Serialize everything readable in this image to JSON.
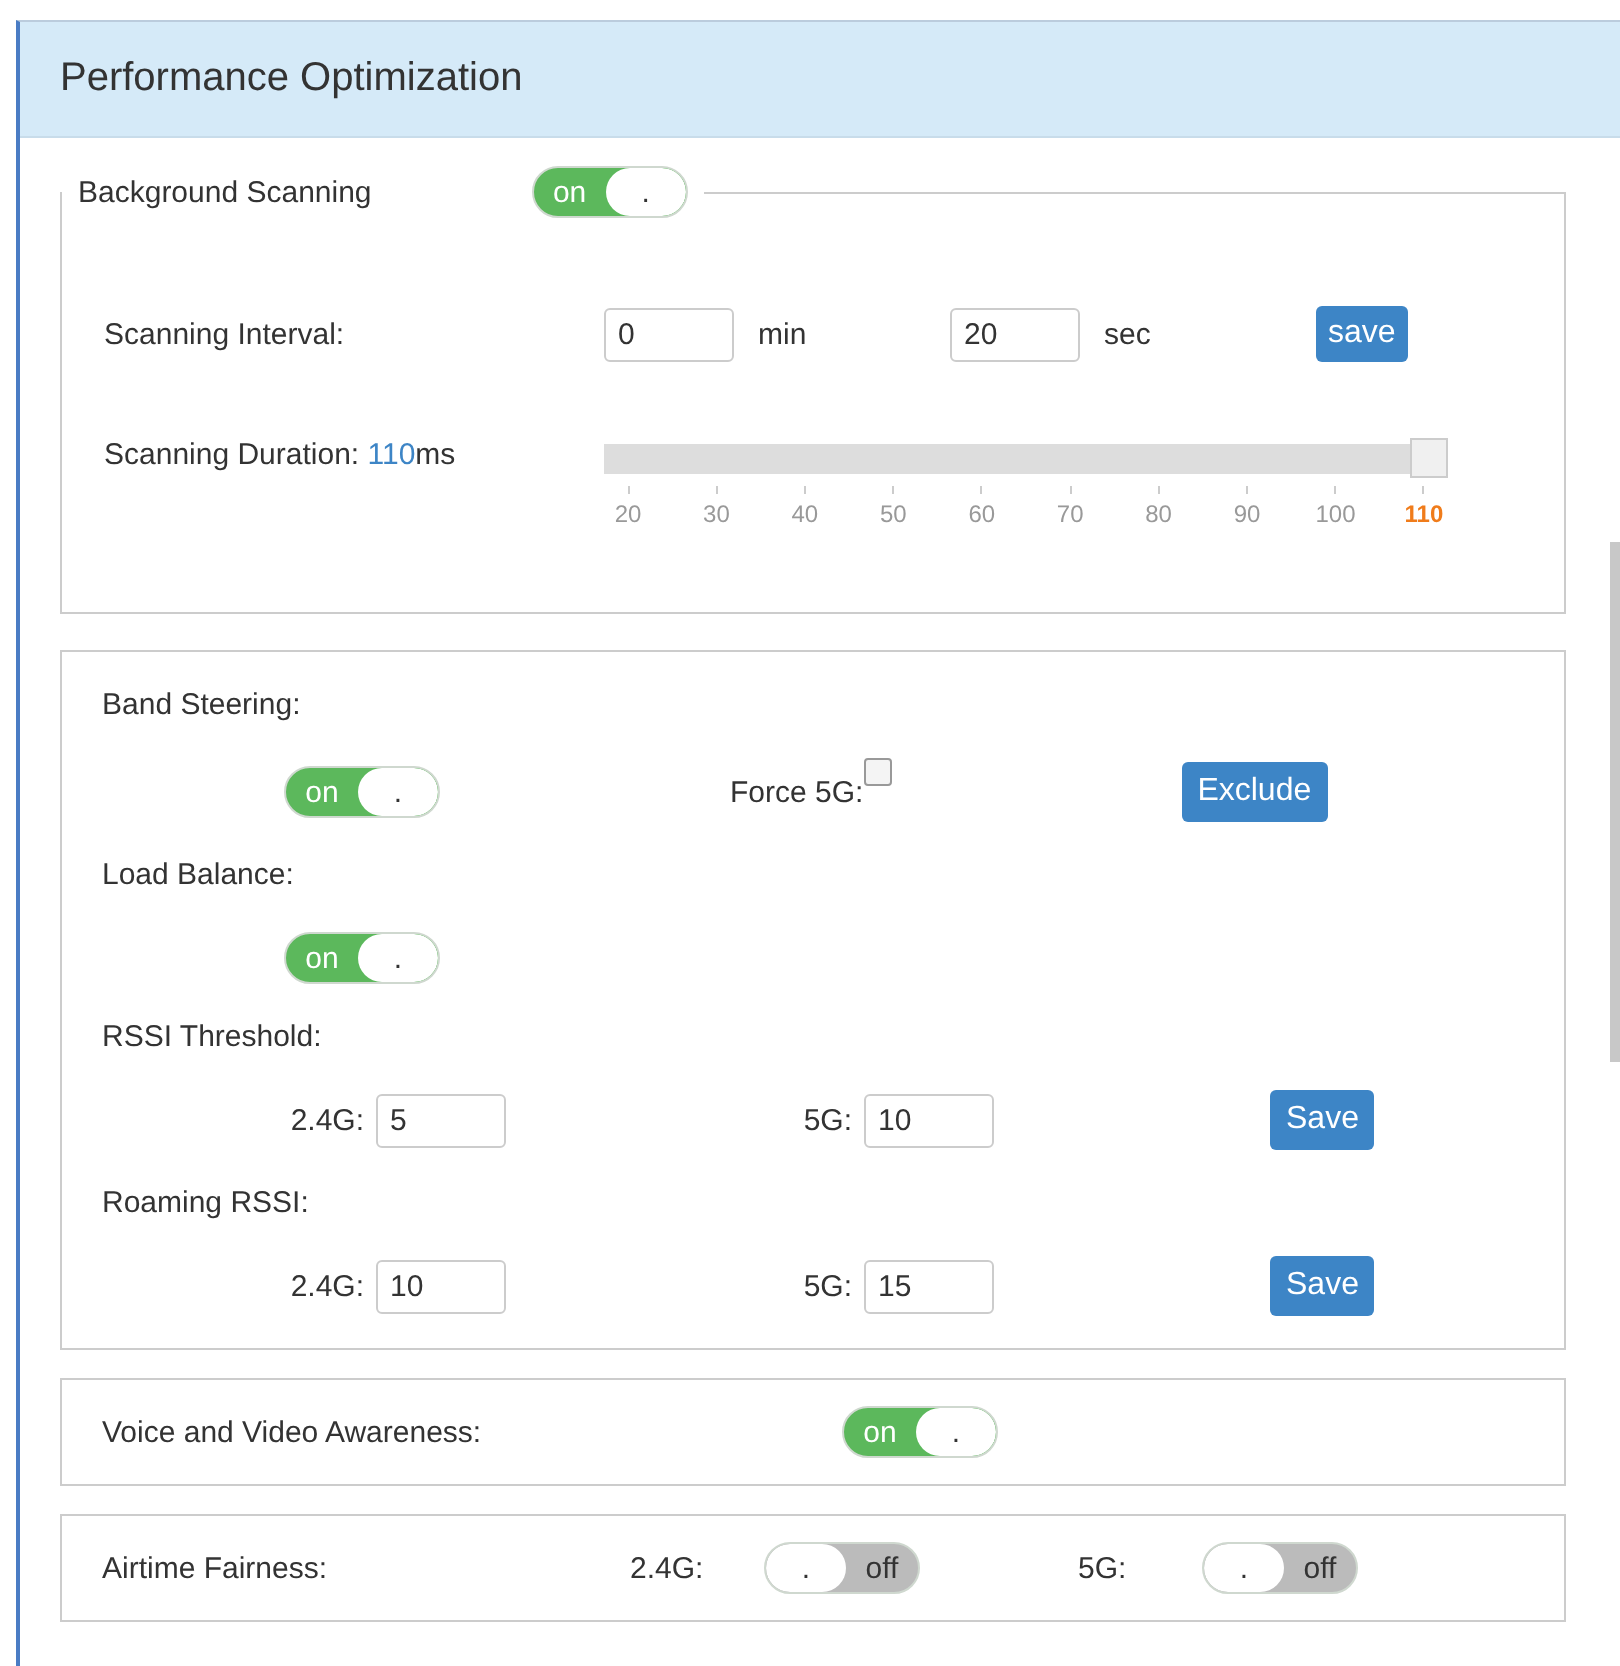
{
  "panel": {
    "title": "Performance Optimization"
  },
  "background_scanning": {
    "label": "Background Scanning",
    "toggle": {
      "on": true,
      "text": "on",
      "knob": "."
    },
    "interval": {
      "label": "Scanning Interval:",
      "minutes": "0",
      "minutes_unit": "min",
      "seconds": "20",
      "seconds_unit": "sec",
      "button": "save"
    },
    "duration": {
      "label": "Scanning Duration: ",
      "value": "110",
      "unit": "ms",
      "level": 1,
      "ticks": [
        "20",
        "30",
        "40",
        "50",
        "60",
        "70",
        "80",
        "90",
        "100",
        "110"
      ]
    }
  },
  "band_steering": {
    "label": "Band Steering:",
    "toggle": {
      "on": true,
      "text": "on",
      "knob": "."
    },
    "force_5g": {
      "label": "Force 5G:",
      "checked": false
    },
    "button": "Exclude"
  },
  "load_balance": {
    "label": "Load Balance:",
    "toggle": {
      "on": true,
      "text": "on",
      "knob": "."
    }
  },
  "rssi_threshold": {
    "label": "RSSI Threshold:",
    "label_24": "2.4G:",
    "value_24": "5",
    "label_5": "5G:",
    "value_5": "10",
    "button": "Save"
  },
  "roaming_rssi": {
    "label": "Roaming RSSI:",
    "label_24": "2.4G:",
    "value_24": "10",
    "label_5": "5G:",
    "value_5": "15",
    "button": "Save"
  },
  "voice_video": {
    "label": "Voice and Video Awareness:",
    "toggle": {
      "on": true,
      "text": "on",
      "knob": "."
    }
  },
  "airtime": {
    "label": "Airtime Fairness:",
    "label_24": "2.4G:",
    "toggle_24": {
      "on": false,
      "text": "off",
      "knob": "."
    },
    "label_5": "5G:",
    "toggle_5": {
      "on": false,
      "text": "off",
      "knob": "."
    }
  }
}
